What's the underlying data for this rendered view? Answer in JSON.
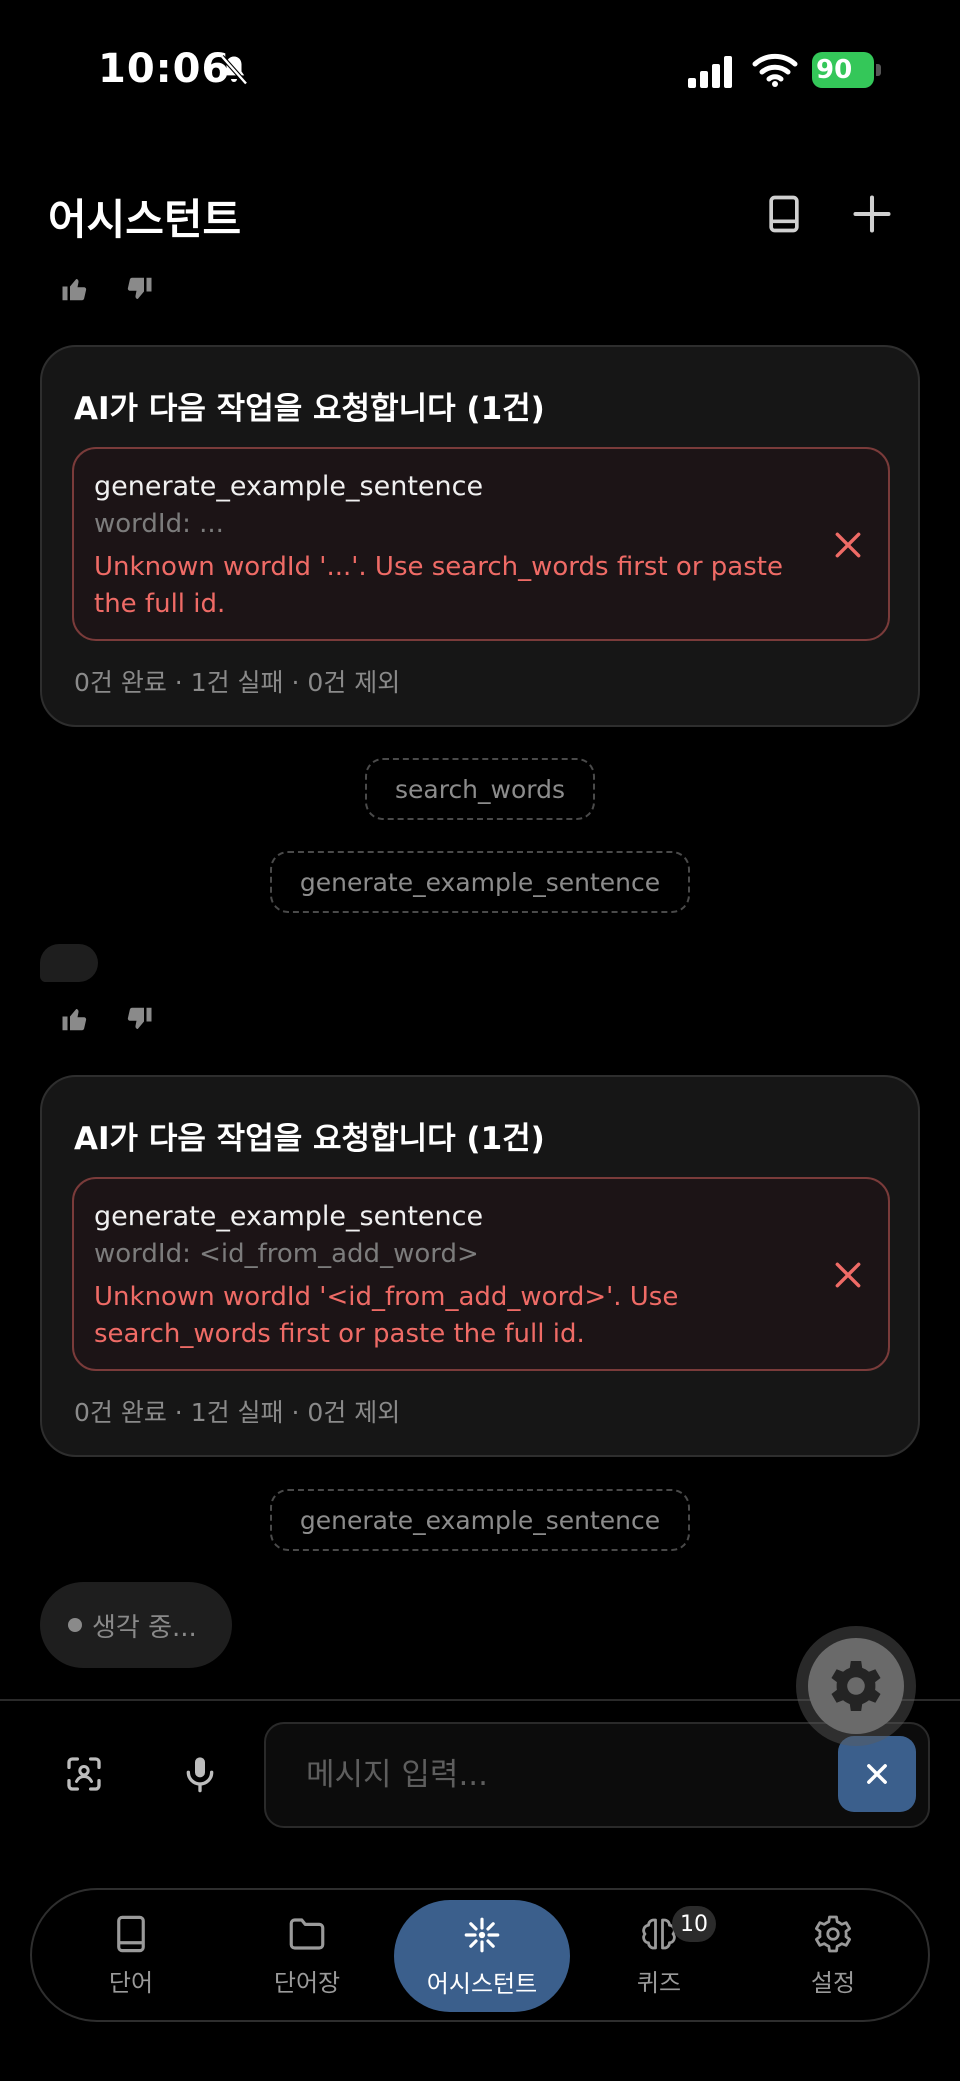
{
  "status_bar": {
    "time": "10:06",
    "battery": "90"
  },
  "header": {
    "title": "어시스턴트"
  },
  "cards": [
    {
      "title": "AI가 다음 작업을 요청합니다 (1건)",
      "tool_name": "generate_example_sentence",
      "tool_arg": "wordId: ...",
      "tool_error": "Unknown wordId '...'. Use search_words first or paste the full id.",
      "summary": "0건 완료 · 1건 실패 · 0건 제외"
    },
    {
      "title": "AI가 다음 작업을 요청합니다 (1건)",
      "tool_name": "generate_example_sentence",
      "tool_arg": "wordId: <id_from_add_word>",
      "tool_error": "Unknown wordId '<id_from_add_word>'. Use search_words first or paste the full id.",
      "summary": "0건 완료 · 1건 실패 · 0건 제외"
    }
  ],
  "chips": {
    "search_words": "search_words",
    "generate_1": "generate_example_sentence",
    "generate_2": "generate_example_sentence"
  },
  "thinking": "생각 중...",
  "input": {
    "placeholder": "메시지 입력..."
  },
  "nav": {
    "words": "단어",
    "wordbooks": "단어장",
    "assistant": "어시스턴트",
    "quiz": "퀴즈",
    "quiz_badge": "10",
    "settings": "설정"
  },
  "colors": {
    "accent": "#3b5f8c",
    "error": "#ef6b66",
    "battery": "#34c759"
  }
}
